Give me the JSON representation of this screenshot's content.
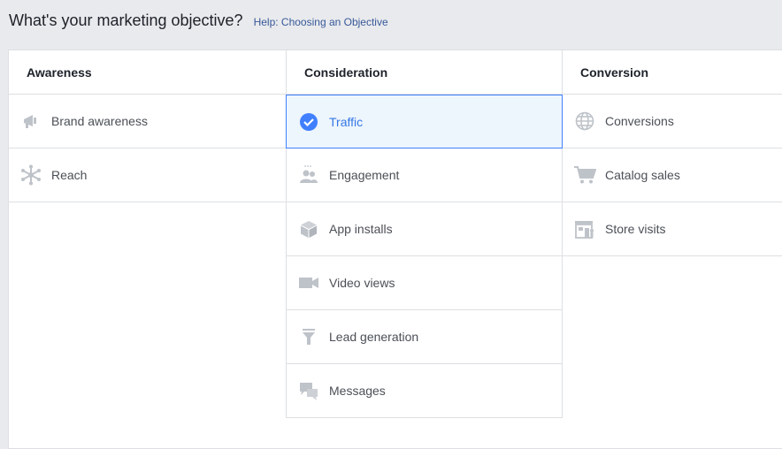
{
  "header": {
    "title": "What's your marketing objective?",
    "help_link": "Help: Choosing an Objective"
  },
  "colors": {
    "accent": "#4080ff",
    "selected_bg": "#edf5fd",
    "icon": "#bec3c9",
    "link": "#365899"
  },
  "columns": [
    {
      "heading": "Awareness",
      "items": [
        {
          "label": "Brand awareness",
          "icon": "megaphone-icon"
        },
        {
          "label": "Reach",
          "icon": "reach-icon"
        }
      ]
    },
    {
      "heading": "Consideration",
      "items": [
        {
          "label": "Traffic",
          "icon": "check-circle-icon",
          "selected": true
        },
        {
          "label": "Engagement",
          "icon": "people-icon"
        },
        {
          "label": "App installs",
          "icon": "box-icon"
        },
        {
          "label": "Video views",
          "icon": "video-camera-icon"
        },
        {
          "label": "Lead generation",
          "icon": "funnel-icon"
        },
        {
          "label": "Messages",
          "icon": "chat-bubbles-icon"
        }
      ]
    },
    {
      "heading": "Conversion",
      "items": [
        {
          "label": "Conversions",
          "icon": "globe-icon"
        },
        {
          "label": "Catalog sales",
          "icon": "cart-icon"
        },
        {
          "label": "Store visits",
          "icon": "store-icon"
        }
      ]
    }
  ]
}
